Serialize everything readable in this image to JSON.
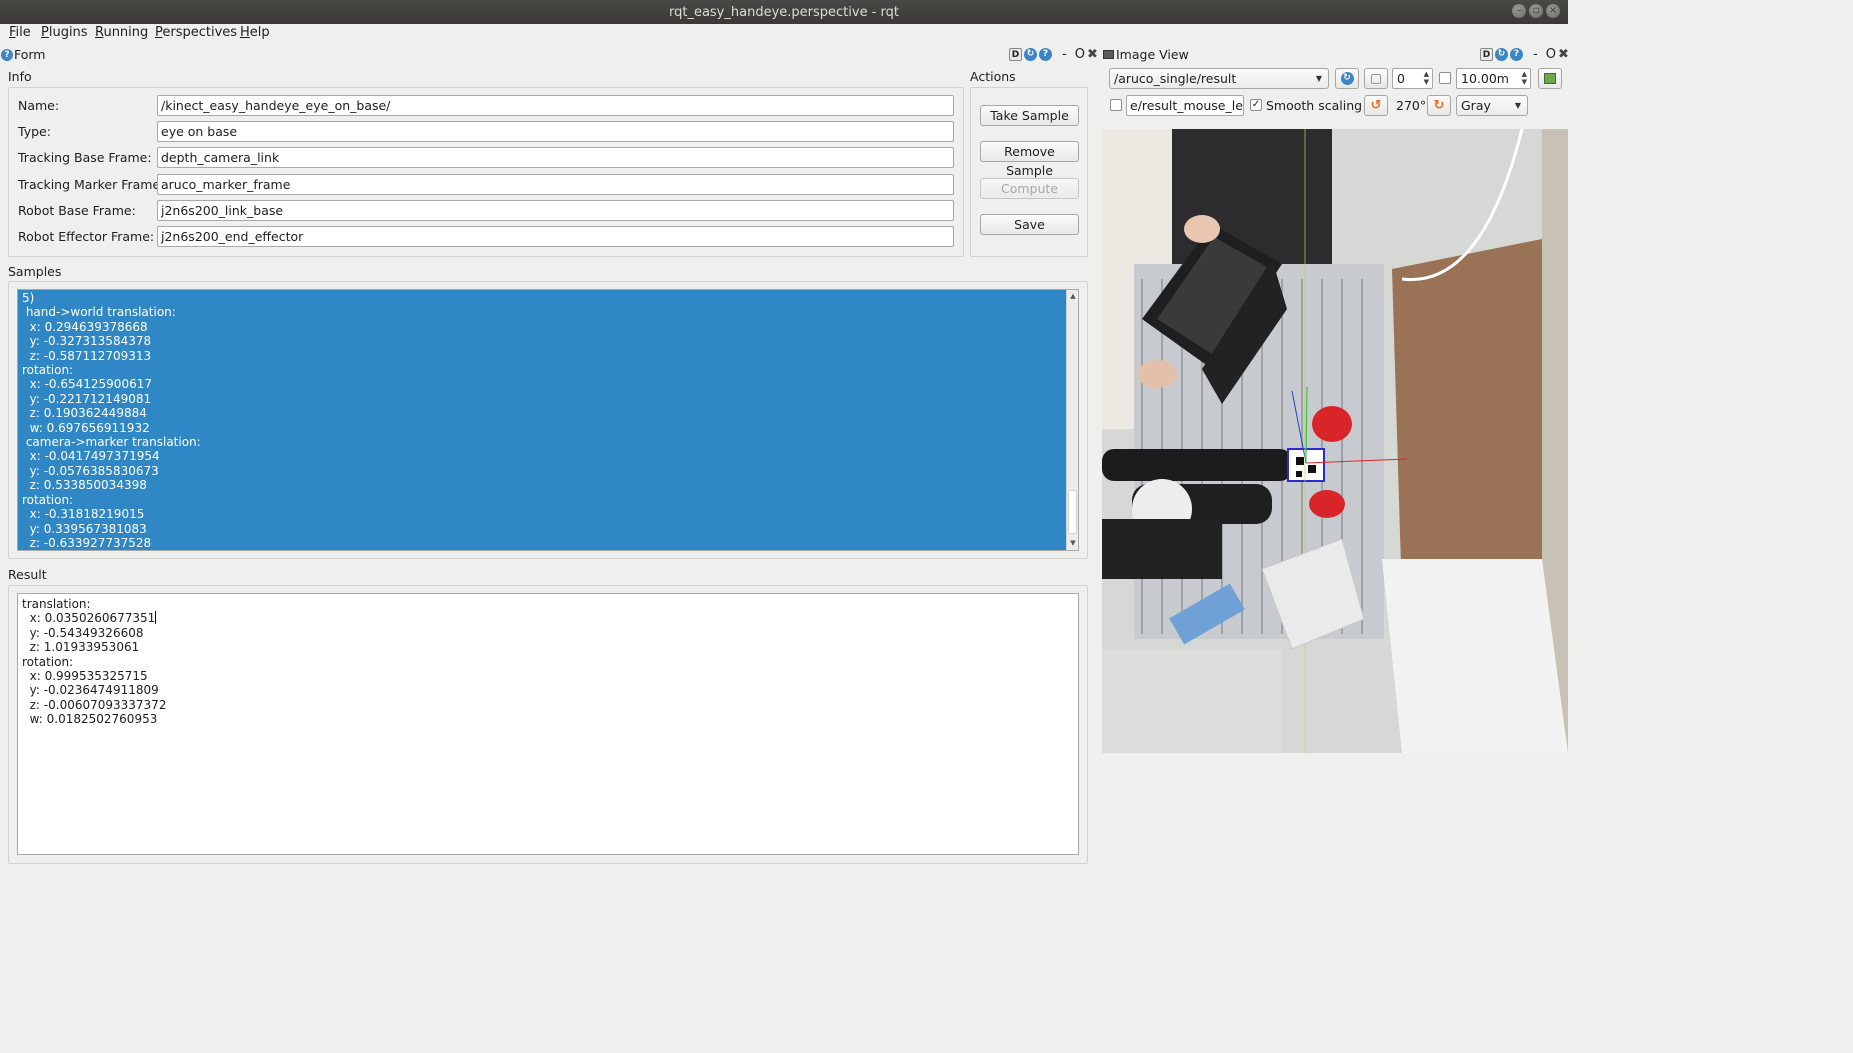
{
  "window": {
    "title": "rqt_easy_handeye.perspective - rqt"
  },
  "menubar": {
    "items": [
      {
        "label": "File",
        "underline": "F",
        "rest": "ile"
      },
      {
        "label": "Plugins",
        "underline": "P",
        "rest": "lugins"
      },
      {
        "label": "Running",
        "underline": "R",
        "rest": "unning"
      },
      {
        "label": "Perspectives",
        "underline": "P",
        "rest": "erspectives"
      },
      {
        "label": "Help",
        "underline": "H",
        "rest": "elp"
      }
    ]
  },
  "form_dock": {
    "title": "Form",
    "buttons": {
      "d": "D",
      "dash": "-",
      "undock": "O"
    },
    "info": {
      "label": "Info",
      "fields": [
        {
          "label": "Name:",
          "value": "/kinect_easy_handeye_eye_on_base/"
        },
        {
          "label": "Type:",
          "value": "eye on base"
        },
        {
          "label": "Tracking Base Frame:",
          "value": "depth_camera_link"
        },
        {
          "label": "Tracking Marker Frame:",
          "value": "aruco_marker_frame"
        },
        {
          "label": "Robot Base Frame:",
          "value": "j2n6s200_link_base"
        },
        {
          "label": "Robot Effector Frame:",
          "value": "j2n6s200_end_effector"
        }
      ]
    },
    "actions": {
      "label": "Actions",
      "take_sample": "Take Sample",
      "remove_sample": "Remove Sample",
      "compute": "Compute",
      "save": "Save"
    },
    "samples": {
      "label": "Samples",
      "text": "5)\n hand->world translation:\n  x: 0.294639378668\n  y: -0.327313584378\n  z: -0.587112709313\nrotation:\n  x: -0.654125900617\n  y: -0.221712149081\n  z: 0.190362449884\n  w: 0.697656911932\n camera->marker translation:\n  x: -0.0417497371954\n  y: -0.0576385830673\n  z: 0.533850034398\nrotation:\n  x: -0.31818219015\n  y: 0.339567381083\n  z: -0.633927737528"
    },
    "result": {
      "label": "Result",
      "text_before_caret": "translation:\n  x: 0.0350260677351",
      "text_after_caret": "\n  y: -0.54349326608\n  z: 1.01933953061\nrotation:\n  x: 0.999535325715\n  y: -0.0236474911809\n  z: -0.00607093337372\n  w: 0.0182502760953"
    }
  },
  "image_dock": {
    "title": "Image View",
    "buttons": {
      "d": "D",
      "dash": "-",
      "undock": "O"
    },
    "topic": "/aruco_single/result",
    "spin_value": "0",
    "max_range": "10.00m",
    "mouse_topic": "e/result_mouse_left",
    "smooth_scaling_label": "Smooth scaling",
    "rotation": "270°",
    "color_scheme": "Gray"
  }
}
